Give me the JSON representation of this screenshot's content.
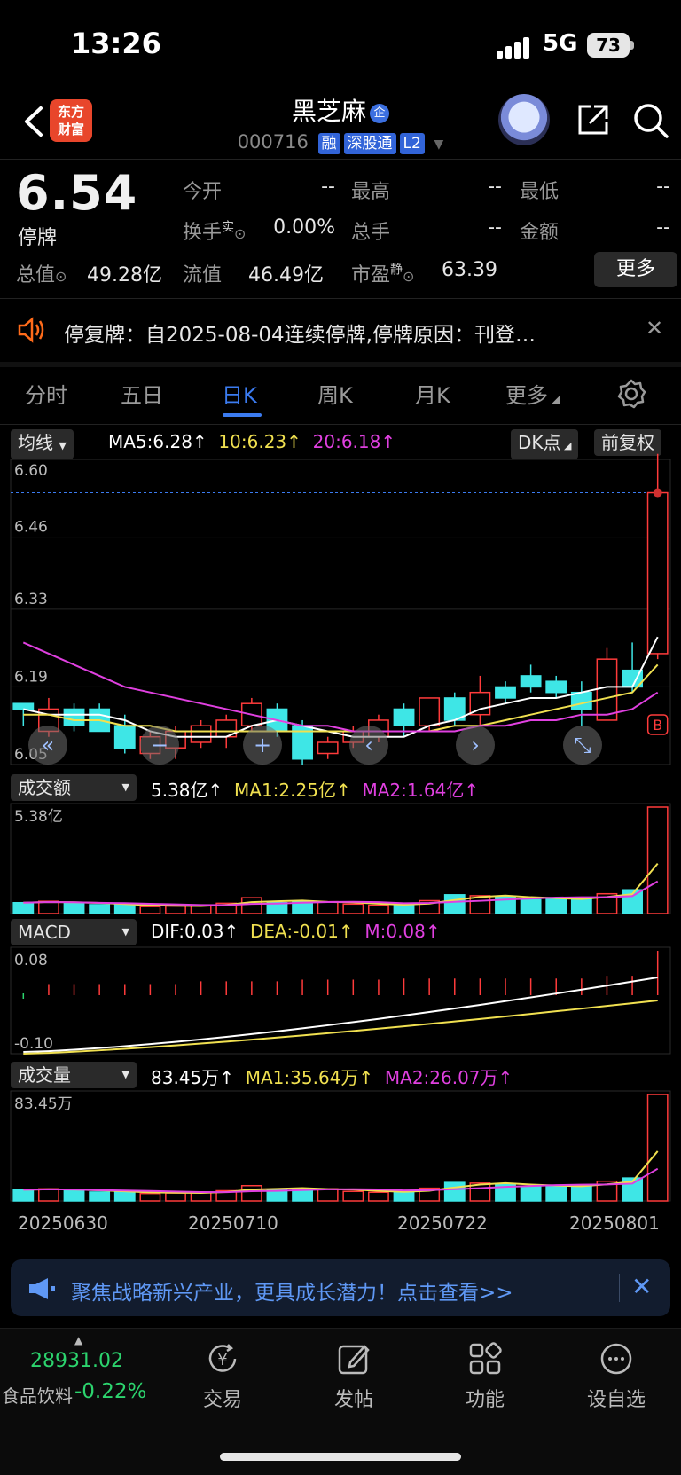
{
  "status": {
    "time": "13:26",
    "network": "5G",
    "battery": "73"
  },
  "header": {
    "logo": "东方\n财富",
    "name": "黑芝麻",
    "ent_badge": "企",
    "code": "000716",
    "tags": [
      "融",
      "深股通",
      "L2"
    ]
  },
  "quote": {
    "price": "6.54",
    "status": "停牌",
    "rows": [
      [
        {
          "label": "今开",
          "value": "--"
        },
        {
          "label": "最高",
          "value": "--"
        },
        {
          "label": "最低",
          "value": "--"
        }
      ],
      [
        {
          "label": "换手",
          "sup": "实",
          "value": "0.00%"
        },
        {
          "label": "总手",
          "value": "--"
        },
        {
          "label": "金额",
          "value": "--"
        }
      ]
    ],
    "row3": [
      {
        "label": "总值",
        "value": "49.28亿"
      },
      {
        "label": "流值",
        "value": "46.49亿"
      },
      {
        "label": "市盈",
        "sup": "静",
        "value": "63.39"
      }
    ],
    "more": "更多"
  },
  "notice": {
    "text": "停复牌：自2025-08-04连续停牌,停牌原因：刊登…"
  },
  "tabs": [
    "分时",
    "五日",
    "日K",
    "周K",
    "月K",
    "更多"
  ],
  "kline": {
    "selector": "均线",
    "ma5": "MA5:6.28↑",
    "ma10": "10:6.23↑",
    "ma20": "20:6.18↑",
    "dk": "DK点",
    "adjust": "前复权",
    "ticks": [
      "6.60",
      "6.46",
      "6.33",
      "6.19",
      "6.05"
    ]
  },
  "amount": {
    "selector": "成交额",
    "value": "5.38亿↑",
    "ma1": "MA1:2.25亿↑",
    "ma2": "MA2:1.64亿↑",
    "top": "5.38亿"
  },
  "macd": {
    "selector": "MACD",
    "dif": "DIF:0.03↑",
    "dea": "DEA:-0.01↑",
    "m": "M:0.08↑",
    "top": "0.08",
    "bottom": "-0.10"
  },
  "volume": {
    "selector": "成交量",
    "value": "83.45万↑",
    "ma1": "MA1:35.64万↑",
    "ma2": "MA2:26.07万↑",
    "top": "83.45万"
  },
  "dates": [
    "20250630",
    "20250710",
    "20250722",
    "20250801"
  ],
  "ad": {
    "text": "聚焦战略新兴产业，更具成长潜力！点击查看>>"
  },
  "bottom": {
    "index_value": "28931.02",
    "index_name": "食品饮料",
    "index_change": "-0.22%",
    "items": [
      "交易",
      "发帖",
      "功能",
      "设自选"
    ]
  },
  "colors": {
    "up": "#ff3b3b",
    "down": "#3ee6e6",
    "accent": "#3b7bf0",
    "ma5": "#ffffff",
    "ma10": "#f0e050",
    "ma20": "#e040e0"
  },
  "chart_data": {
    "type": "candlestick",
    "x": [
      "20250630",
      "",
      "",
      "",
      "",
      "",
      "",
      "",
      "20250710",
      "",
      "",
      "",
      "",
      "",
      "",
      "",
      "20250722",
      "",
      "",
      "",
      "",
      "",
      "",
      "",
      "20250801"
    ],
    "ylim": [
      6.05,
      6.6
    ],
    "candles": [
      {
        "o": 6.16,
        "h": 6.16,
        "l": 6.12,
        "c": 6.15
      },
      {
        "o": 6.11,
        "h": 6.17,
        "l": 6.1,
        "c": 6.15
      },
      {
        "o": 6.15,
        "h": 6.16,
        "l": 6.11,
        "c": 6.12
      },
      {
        "o": 6.15,
        "h": 6.16,
        "l": 6.11,
        "c": 6.11
      },
      {
        "o": 6.12,
        "h": 6.14,
        "l": 6.07,
        "c": 6.08
      },
      {
        "o": 6.07,
        "h": 6.11,
        "l": 6.06,
        "c": 6.1
      },
      {
        "o": 6.08,
        "h": 6.12,
        "l": 6.06,
        "c": 6.11
      },
      {
        "o": 6.09,
        "h": 6.13,
        "l": 6.08,
        "c": 6.12
      },
      {
        "o": 6.1,
        "h": 6.14,
        "l": 6.08,
        "c": 6.13
      },
      {
        "o": 6.12,
        "h": 6.17,
        "l": 6.11,
        "c": 6.16
      },
      {
        "o": 6.15,
        "h": 6.16,
        "l": 6.1,
        "c": 6.11
      },
      {
        "o": 6.12,
        "h": 6.13,
        "l": 6.05,
        "c": 6.06
      },
      {
        "o": 6.07,
        "h": 6.1,
        "l": 6.06,
        "c": 6.09
      },
      {
        "o": 6.09,
        "h": 6.12,
        "l": 6.08,
        "c": 6.11
      },
      {
        "o": 6.1,
        "h": 6.14,
        "l": 6.09,
        "c": 6.13
      },
      {
        "o": 6.15,
        "h": 6.16,
        "l": 6.1,
        "c": 6.12
      },
      {
        "o": 6.12,
        "h": 6.17,
        "l": 6.11,
        "c": 6.17
      },
      {
        "o": 6.17,
        "h": 6.18,
        "l": 6.12,
        "c": 6.13
      },
      {
        "o": 6.14,
        "h": 6.21,
        "l": 6.12,
        "c": 6.18
      },
      {
        "o": 6.19,
        "h": 6.2,
        "l": 6.16,
        "c": 6.17
      },
      {
        "o": 6.21,
        "h": 6.23,
        "l": 6.18,
        "c": 6.19
      },
      {
        "o": 6.2,
        "h": 6.21,
        "l": 6.17,
        "c": 6.18
      },
      {
        "o": 6.18,
        "h": 6.2,
        "l": 6.12,
        "c": 6.15
      },
      {
        "o": 6.13,
        "h": 6.26,
        "l": 6.13,
        "c": 6.24
      },
      {
        "o": 6.22,
        "h": 6.27,
        "l": 6.18,
        "c": 6.19
      },
      {
        "o": 6.25,
        "h": 6.61,
        "l": 6.24,
        "c": 6.54
      }
    ],
    "series": [
      {
        "name": "MA5",
        "values": [
          6.15,
          6.14,
          6.14,
          6.14,
          6.13,
          6.11,
          6.1,
          6.1,
          6.1,
          6.12,
          6.13,
          6.12,
          6.11,
          6.1,
          6.1,
          6.1,
          6.12,
          6.13,
          6.15,
          6.16,
          6.17,
          6.17,
          6.18,
          6.19,
          6.19,
          6.28
        ]
      },
      {
        "name": "MA10",
        "values": [
          6.14,
          6.14,
          6.13,
          6.13,
          6.12,
          6.12,
          6.11,
          6.11,
          6.11,
          6.11,
          6.11,
          6.11,
          6.11,
          6.11,
          6.11,
          6.11,
          6.11,
          6.12,
          6.12,
          6.13,
          6.14,
          6.15,
          6.16,
          6.17,
          6.18,
          6.23
        ]
      },
      {
        "name": "20",
        "values": [
          6.27,
          6.25,
          6.23,
          6.21,
          6.19,
          6.18,
          6.17,
          6.16,
          6.15,
          6.14,
          6.13,
          6.12,
          6.12,
          6.11,
          6.11,
          6.11,
          6.11,
          6.11,
          6.12,
          6.12,
          6.13,
          6.13,
          6.14,
          6.14,
          6.15,
          6.18
        ]
      }
    ],
    "amount": {
      "values": [
        0.55,
        0.62,
        0.55,
        0.45,
        0.45,
        0.35,
        0.38,
        0.42,
        0.52,
        0.8,
        0.55,
        0.62,
        0.6,
        0.48,
        0.42,
        0.45,
        0.65,
        0.95,
        0.9,
        0.88,
        0.7,
        0.75,
        0.75,
        1.0,
        1.2,
        5.38
      ],
      "ma1": 2.25,
      "ma2": 1.64,
      "max": 5.38
    },
    "macd": {
      "hist": [
        -0.002,
        0.02,
        0.02,
        0.02,
        0.02,
        0.02,
        0.02,
        0.025,
        0.025,
        0.025,
        0.025,
        0.028,
        0.028,
        0.028,
        0.028,
        0.03,
        0.03,
        0.03,
        0.03,
        0.03,
        0.03,
        0.03,
        0.03,
        0.035,
        0.035,
        0.08
      ],
      "dif": 0.03,
      "dea": -0.01,
      "range": [
        -0.1,
        0.08
      ]
    },
    "volume": {
      "values": [
        8.8,
        9.5,
        8.5,
        7.0,
        7.2,
        5.8,
        6.2,
        6.8,
        8.0,
        12.0,
        8.5,
        9.8,
        9.5,
        7.5,
        6.8,
        7.2,
        10.0,
        14.5,
        14.0,
        13.5,
        11.0,
        11.8,
        11.8,
        15.5,
        18.0,
        83.45
      ],
      "ma1": 35.64,
      "ma2": 26.07,
      "max": 83.45
    }
  }
}
